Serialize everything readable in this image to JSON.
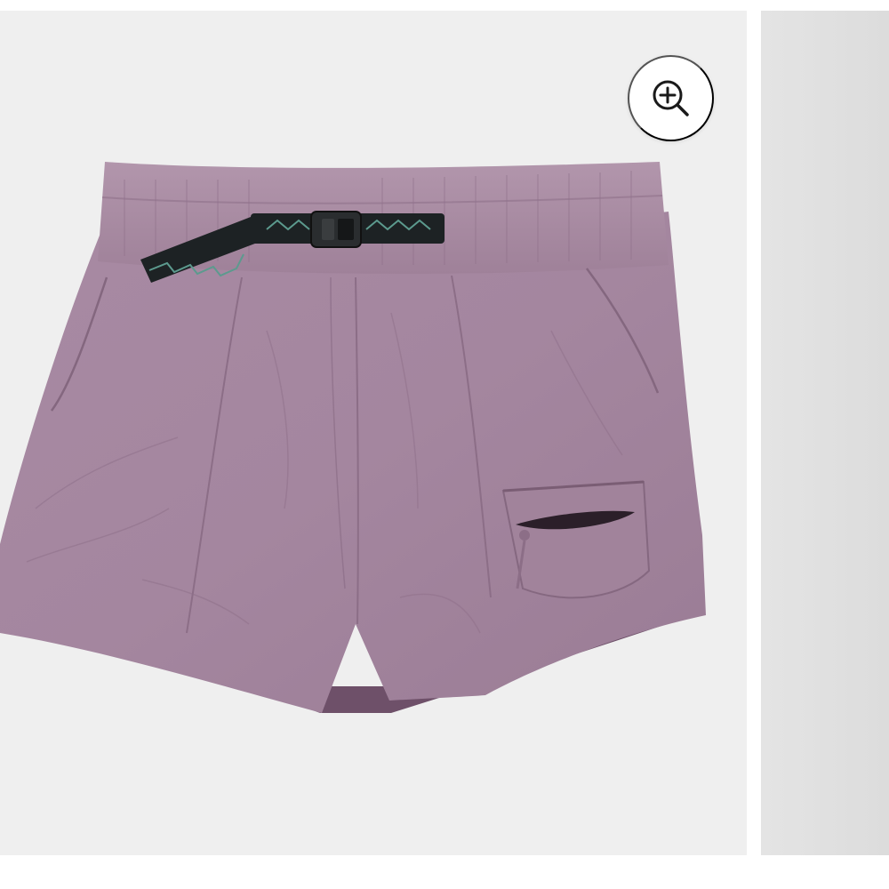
{
  "gallery": {
    "zoom_icon": "zoom-in-icon",
    "product_color": "#a4869f",
    "product_shadow_color": "#7c5f77",
    "strap_color": "#1d2224",
    "strap_pattern_color": "#5c9a8e",
    "main_background": "#efefef",
    "next_background": "#dcdcdc"
  }
}
